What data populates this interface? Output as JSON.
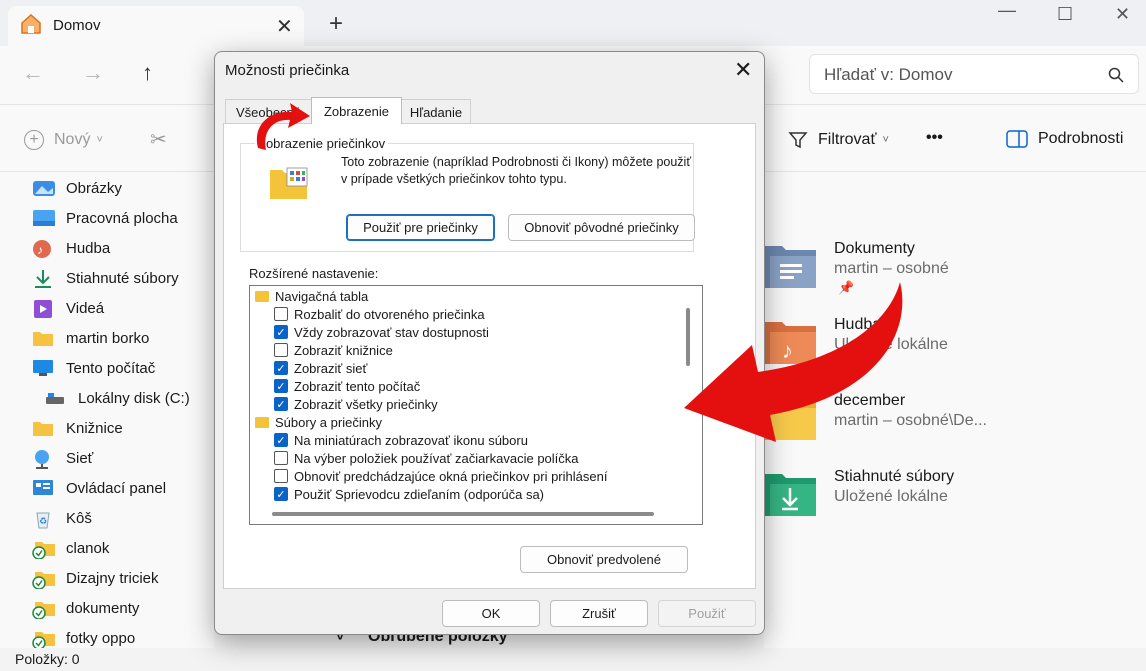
{
  "explorer": {
    "tab_title": "Domov",
    "search_placeholder": "Hľadať v: Domov",
    "new_label": "Nový",
    "filter_label": "Filtrovať",
    "more_label": "•••",
    "details_label": "Podrobnosti",
    "status": "Položky: 0",
    "behind_group_label": "Obľúbené položky",
    "sidebar": [
      {
        "label": "Obrázky",
        "icon": "pictures-icon"
      },
      {
        "label": "Pracovná plocha",
        "icon": "desktop-icon"
      },
      {
        "label": "Hudba",
        "icon": "music-icon"
      },
      {
        "label": "Stiahnuté súbory",
        "icon": "download-icon"
      },
      {
        "label": "Videá",
        "icon": "video-icon"
      },
      {
        "label": "martin borko",
        "icon": "folder-icon"
      },
      {
        "label": "Tento počítač",
        "icon": "computer-icon"
      },
      {
        "label": "Lokálny disk (C:)",
        "icon": "drive-icon"
      },
      {
        "label": "Knižnice",
        "icon": "folder-icon"
      },
      {
        "label": "Sieť",
        "icon": "network-icon"
      },
      {
        "label": "Ovládací panel",
        "icon": "control-panel-icon"
      },
      {
        "label": "Kôš",
        "icon": "recycle-bin-icon"
      },
      {
        "label": "clanok",
        "icon": "synced-folder-icon"
      },
      {
        "label": "Dizajny triciek",
        "icon": "synced-folder-icon"
      },
      {
        "label": "dokumenty",
        "icon": "synced-folder-icon"
      },
      {
        "label": "fotky oppo",
        "icon": "synced-folder-icon"
      }
    ],
    "items": [
      {
        "title": "Dokumenty",
        "sub": "martin – osobné"
      },
      {
        "title": "Hudba",
        "sub": "Uložené lokálne"
      },
      {
        "title": "december",
        "sub": "martin – osobné\\De..."
      },
      {
        "title": "Stiahnuté súbory",
        "sub": "Uložené lokálne"
      }
    ]
  },
  "dialog": {
    "title": "Možnosti priečinka",
    "tabs": [
      "Všeobecné",
      "Zobrazenie",
      "Hľadanie"
    ],
    "active_tab": "Zobrazenie",
    "group_label": "Zobrazenie priečinkov",
    "description": "Toto zobrazenie (napríklad Podrobnosti či Ikony) môžete použiť v prípade všetkých priečinkov tohto typu.",
    "apply_folders_btn": "Použiť pre priečinky",
    "reset_folders_btn": "Obnoviť pôvodné priečinky",
    "advanced_label": "Rozšírené nastavenie:",
    "tree": [
      {
        "type": "folder",
        "label": "Navigačná tabla"
      },
      {
        "type": "check",
        "label": "Rozbaliť do otvoreného priečinka",
        "checked": false
      },
      {
        "type": "check",
        "label": "Vždy zobrazovať stav dostupnosti",
        "checked": true
      },
      {
        "type": "check",
        "label": "Zobraziť knižnice",
        "checked": false
      },
      {
        "type": "check",
        "label": "Zobraziť sieť",
        "checked": true
      },
      {
        "type": "check",
        "label": "Zobraziť tento počítač",
        "checked": true
      },
      {
        "type": "check",
        "label": "Zobraziť všetky priečinky",
        "checked": true
      },
      {
        "type": "folder",
        "label": "Súbory a priečinky"
      },
      {
        "type": "check",
        "label": "Na miniatúrach zobrazovať ikonu súboru",
        "checked": true
      },
      {
        "type": "check",
        "label": "Na výber položiek používať začiarkavacie políčka",
        "checked": false
      },
      {
        "type": "check",
        "label": "Obnoviť predchádzajúce okná priečinkov pri prihlásení",
        "checked": false
      },
      {
        "type": "check",
        "label": "Použiť Sprievodcu zdieľaním (odporúča sa)",
        "checked": true
      }
    ],
    "restore_defaults_btn": "Obnoviť predvolené",
    "ok_btn": "OK",
    "cancel_btn": "Zrušiť",
    "apply_btn": "Použiť"
  }
}
